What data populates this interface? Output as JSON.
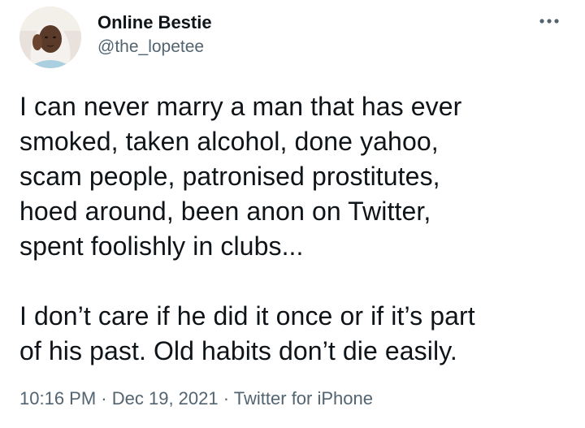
{
  "user": {
    "display_name": "Online Bestie",
    "handle": "@the_lopetee"
  },
  "icons": {
    "avatar": "profile-avatar",
    "more": "more-horizontal-icon"
  },
  "tweet": {
    "lines_para1": [
      "I can never marry a man that has ever",
      "smoked, taken alcohol, done yahoo,",
      "scam people, patronised prostitutes,",
      "hoed around, been anon on Twitter,",
      "spent foolishly in clubs..."
    ],
    "lines_para2": [
      "I don’t care if he did it once or if it’s part",
      "of his past. Old habits don’t die easily."
    ]
  },
  "meta": {
    "time": "10:16 PM",
    "separator": "·",
    "date": "Dec 19, 2021",
    "source": "Twitter for iPhone"
  },
  "colors": {
    "text_primary": "#0f1419",
    "text_secondary": "#536471"
  }
}
